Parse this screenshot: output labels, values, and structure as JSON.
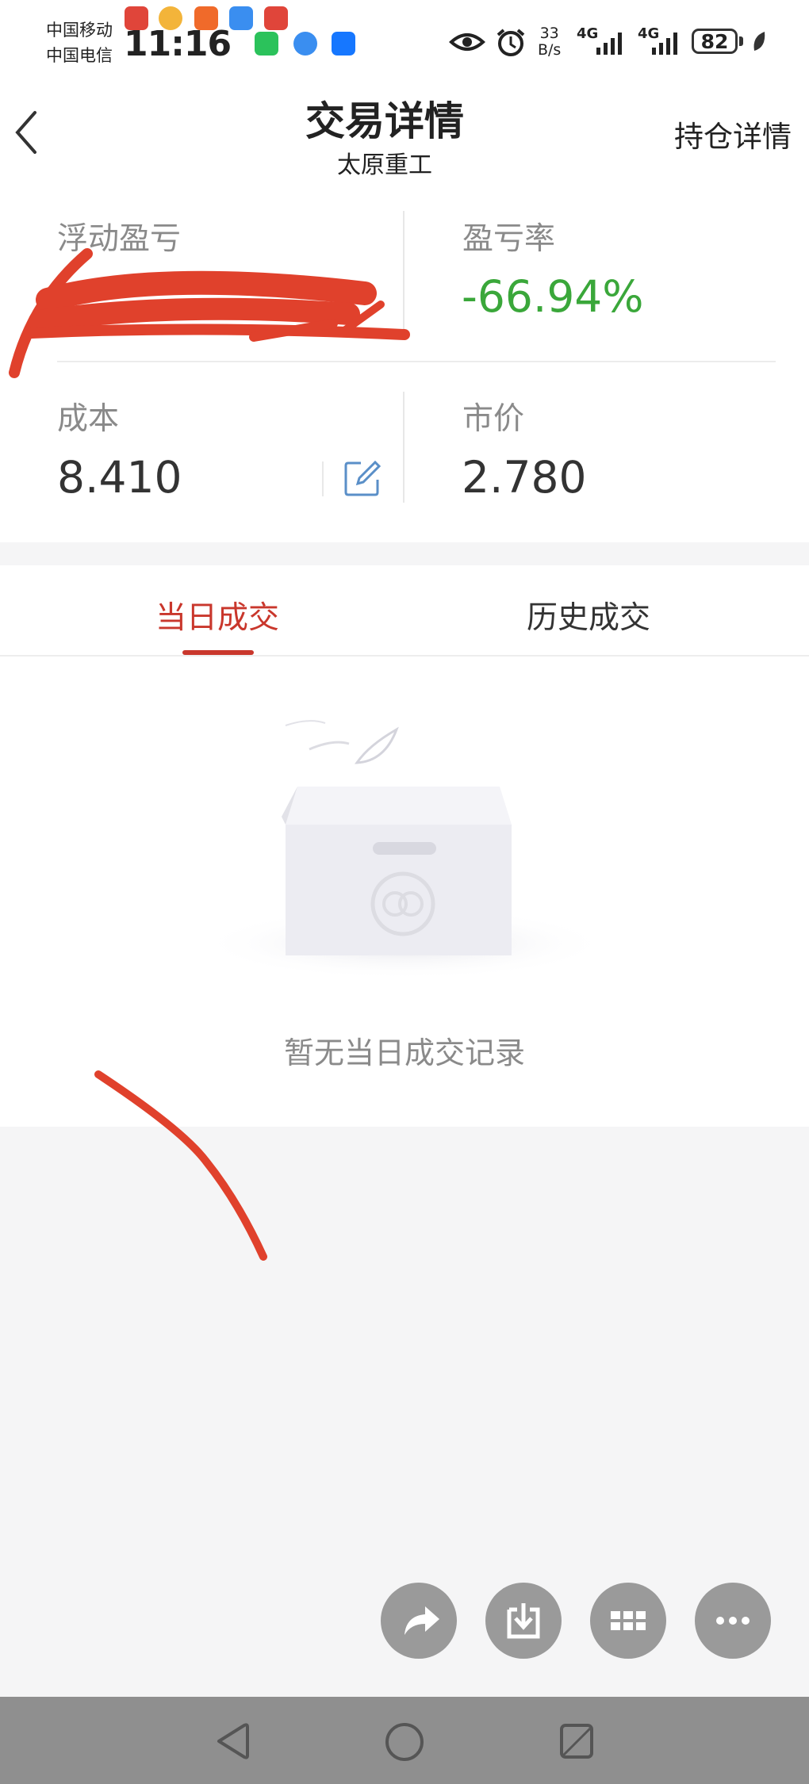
{
  "status_bar": {
    "carrier_1": "中国移动",
    "carrier_2": "中国电信",
    "time": "11:16",
    "speed_value": "33",
    "speed_unit": "B/s",
    "network_1": "4G",
    "network_2": "4G",
    "battery": "82"
  },
  "header": {
    "title": "交易详情",
    "subtitle": "太原重工",
    "right_action": "持仓详情"
  },
  "summary": {
    "float_pnl_label": "浮动盈亏",
    "pnl_rate_label": "盈亏率",
    "pnl_rate_value": "-66.94%",
    "cost_label": "成本",
    "cost_value": "8.410",
    "price_label": "市价",
    "price_value": "2.780"
  },
  "tabs": [
    {
      "label": "当日成交",
      "active": true
    },
    {
      "label": "历史成交",
      "active": false
    }
  ],
  "empty_state": {
    "message": "暂无当日成交记录"
  },
  "fab_icons": [
    "share-icon",
    "download-icon",
    "grid-icon",
    "more-icon"
  ],
  "colors": {
    "accent": "#c9372c",
    "negative": "#3aa73a",
    "scribble": "#e0412c"
  }
}
